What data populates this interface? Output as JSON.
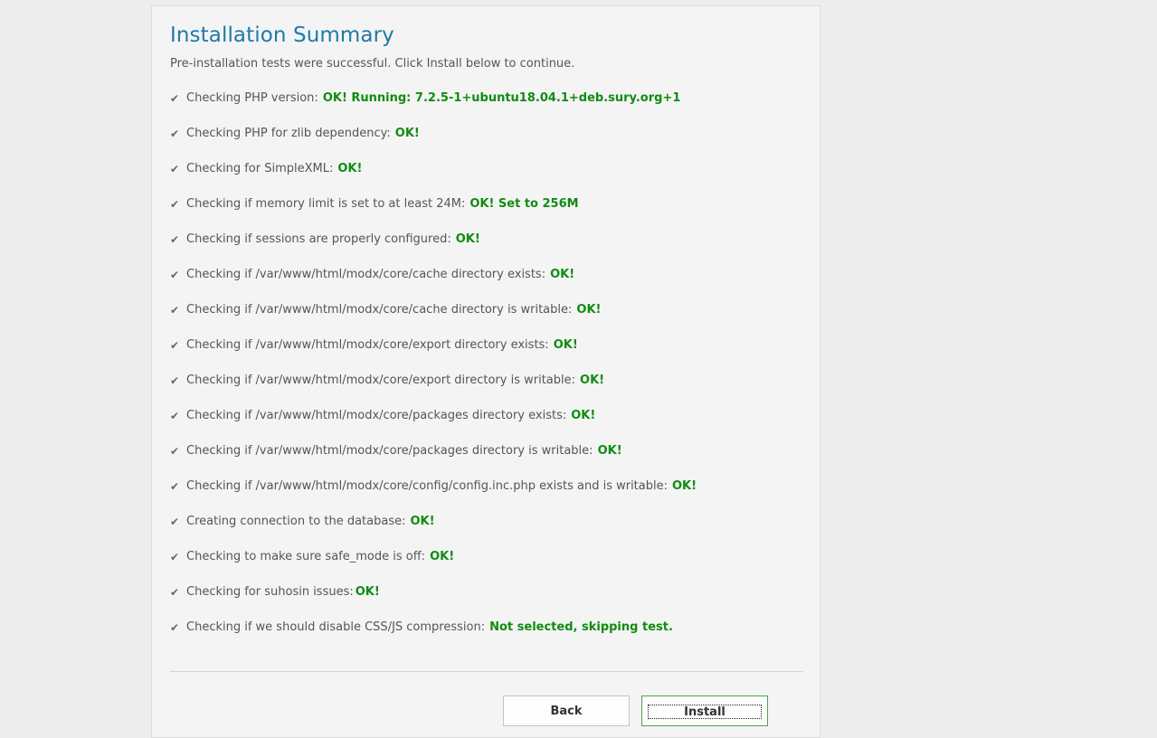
{
  "summary": {
    "title": "Installation Summary",
    "intro": "Pre-installation tests were successful. Click Install below to continue."
  },
  "checks": [
    {
      "label": "Checking PHP version:",
      "result": "OK! Running: 7.2.5-1+ubuntu18.04.1+deb.sury.org+1"
    },
    {
      "label": "Checking PHP for zlib dependency:",
      "result": "OK!"
    },
    {
      "label": "Checking for SimpleXML:",
      "result": "OK!"
    },
    {
      "label": "Checking if memory limit is set to at least 24M:",
      "result": "OK! Set to 256M"
    },
    {
      "label": "Checking if sessions are properly configured:",
      "result": "OK!"
    },
    {
      "label": "Checking if /var/www/html/modx/core/cache directory exists:",
      "result": "OK!"
    },
    {
      "label": "Checking if /var/www/html/modx/core/cache directory is writable:",
      "result": "OK!"
    },
    {
      "label": "Checking if /var/www/html/modx/core/export directory exists:",
      "result": "OK!"
    },
    {
      "label": "Checking if /var/www/html/modx/core/export directory is writable:",
      "result": "OK!"
    },
    {
      "label": "Checking if /var/www/html/modx/core/packages directory exists:",
      "result": "OK!"
    },
    {
      "label": "Checking if /var/www/html/modx/core/packages directory is writable:",
      "result": "OK!"
    },
    {
      "label": "Checking if /var/www/html/modx/core/config/config.inc.php exists and is writable:",
      "result": "OK!"
    },
    {
      "label": "Creating connection to the database:",
      "result": "OK!"
    },
    {
      "label": "Checking to make sure safe_mode is off:",
      "result": "OK!"
    },
    {
      "label": "Checking for suhosin issues:",
      "result": "OK!"
    },
    {
      "label": "Checking if we should disable CSS/JS compression:",
      "result": "Not selected, skipping test."
    }
  ],
  "buttons": {
    "back": "Back",
    "install": "Install"
  },
  "icons": {
    "check": "check-icon"
  },
  "colors": {
    "title": "#1e7aa8",
    "success": "#118c11",
    "background": "#ededed"
  }
}
